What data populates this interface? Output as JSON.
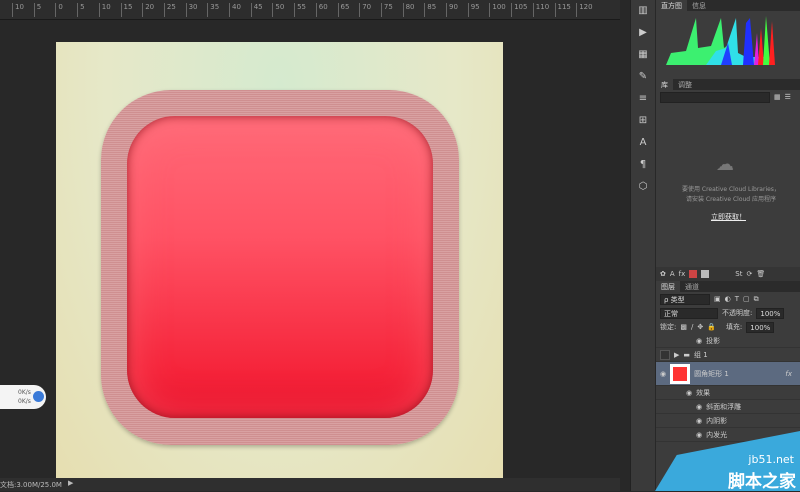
{
  "ruler": {
    "labels": [
      "10",
      "5",
      "0",
      "5",
      "10",
      "15",
      "20",
      "25",
      "30",
      "35",
      "40",
      "45",
      "50",
      "55",
      "60",
      "65",
      "70",
      "75",
      "80",
      "85",
      "90",
      "95",
      "100",
      "105",
      "110",
      "115",
      "120"
    ]
  },
  "status": {
    "doc_size": "文档:3.00M/25.0M"
  },
  "network": {
    "up": "0K/s",
    "down": "0K/s"
  },
  "tools": [
    "play-icon",
    "swatches-icon",
    "brush-icon",
    "adjust-icon",
    "type-icon",
    "paragraph-icon",
    "3d-icon"
  ],
  "histogram": {
    "tabs": [
      "直方图",
      "信息"
    ]
  },
  "library": {
    "tabs": [
      "库",
      "调整"
    ],
    "message1": "要使用 Creative Cloud Libraries，",
    "message2": "请安装 Creative Cloud 应用程序",
    "link": "立即获取！"
  },
  "layers": {
    "tabs": [
      "图层",
      "通道"
    ],
    "filter": "ρ 类型",
    "blend": "正常",
    "opacity_label": "不透明度:",
    "opacity": "100%",
    "lock_label": "锁定:",
    "fill_label": "填充:",
    "fill": "100%",
    "items": [
      {
        "name": "投影",
        "indent": 2
      },
      {
        "name": "组 1",
        "indent": 1,
        "folder": true
      },
      {
        "name": "圆角矩形 1",
        "indent": 1,
        "selected": true,
        "fx": "fx"
      },
      {
        "name": "效果",
        "indent": 2
      },
      {
        "name": "斜面和浮雕",
        "indent": 3
      },
      {
        "name": "内阴影",
        "indent": 3
      },
      {
        "name": "内发光",
        "indent": 3
      }
    ]
  },
  "watermark": {
    "url": "jb51.net",
    "name": "脚本之家"
  },
  "colors": {
    "shape": "#ff4b5c",
    "frame": "#d59a9b",
    "accent": "#3aa9dc"
  }
}
